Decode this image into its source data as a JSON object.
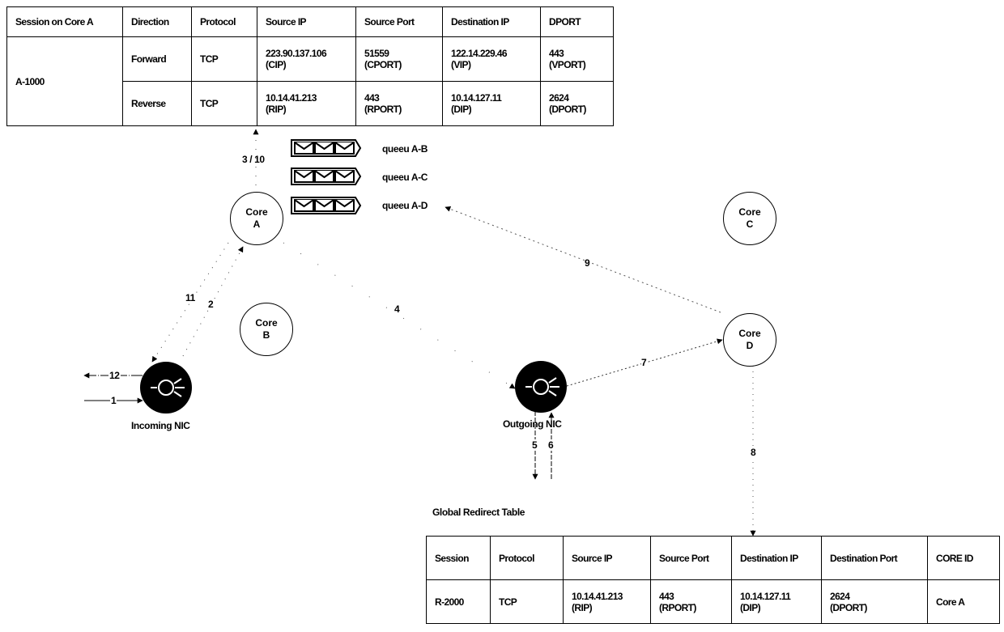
{
  "session_table": {
    "headers": [
      "Session on Core A",
      "Direction",
      "Protocol",
      "Source IP",
      "Source Port",
      "Destination IP",
      "DPORT"
    ],
    "session": "A-1000",
    "rows": [
      {
        "direction": "Forward",
        "protocol": "TCP",
        "source_ip": "223.90.137.106",
        "source_ip_tag": "(CIP)",
        "source_port": "51559",
        "source_port_tag": "(CPORT)",
        "dest_ip": "122.14.229.46",
        "dest_ip_tag": "(VIP)",
        "dport": "443",
        "dport_tag": "(VPORT)"
      },
      {
        "direction": "Reverse",
        "protocol": "TCP",
        "source_ip": "10.14.41.213",
        "source_ip_tag": "(RIP)",
        "source_port": "443",
        "source_port_tag": "(RPORT)",
        "dest_ip": "10.14.127.11",
        "dest_ip_tag": "(DIP)",
        "dport": "2624",
        "dport_tag": "(DPORT)"
      }
    ]
  },
  "queues": [
    {
      "label": "queeu A-B",
      "icon": "envelope-icon"
    },
    {
      "label": "queeu A-C",
      "icon": "envelope-icon"
    },
    {
      "label": "queeu A-D",
      "icon": "envelope-icon"
    }
  ],
  "cores": {
    "a": {
      "line1": "Core",
      "line2": "A"
    },
    "b": {
      "line1": "Core",
      "line2": "B"
    },
    "c": {
      "line1": "Core",
      "line2": "C"
    },
    "d": {
      "line1": "Core",
      "line2": "D"
    }
  },
  "nics": {
    "incoming": "Incoming NIC",
    "outgoing": "Outgoing NIC"
  },
  "step_labels": {
    "s1": "1",
    "s2": "2",
    "s3_10": "3 / 10",
    "s4": "4",
    "s5": "5",
    "s6": "6",
    "s7": "7",
    "s8": "8",
    "s9": "9",
    "s11": "11",
    "s12": "12"
  },
  "redirect_table": {
    "title": "Global Redirect Table",
    "headers": [
      "Session",
      "Protocol",
      "Source IP",
      "Source Port",
      "Destination IP",
      "Destination Port",
      "CORE ID"
    ],
    "rows": [
      {
        "session": "R-2000",
        "protocol": "TCP",
        "source_ip": "10.14.41.213",
        "source_ip_tag": "(RIP)",
        "source_port": "443",
        "source_port_tag": "(RPORT)",
        "dest_ip": "10.14.127.11",
        "dest_ip_tag": "(DIP)",
        "dest_port": "2624",
        "dest_port_tag": "(DPORT)",
        "core_id": "Core A"
      }
    ]
  }
}
